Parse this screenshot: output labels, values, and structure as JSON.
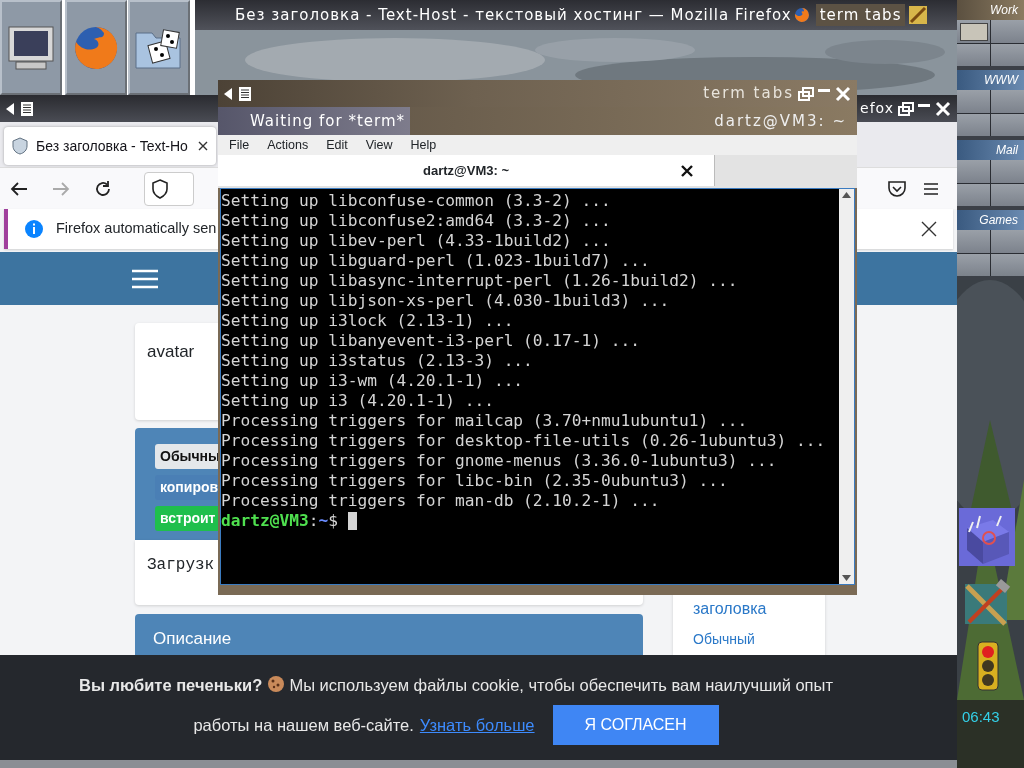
{
  "launcher": [
    {
      "kind": "monitor"
    },
    {
      "kind": "browser"
    },
    {
      "kind": "games"
    }
  ],
  "top_bar": {
    "title": "Без заголовка - Text-Host - текстовый хостинг — Mozilla Firefox",
    "second_title": "term tabs"
  },
  "pager": {
    "desks": [
      {
        "label": "Work",
        "selected": true
      },
      {
        "label": "WWW",
        "selected": false
      },
      {
        "label": "Mail",
        "selected": false
      },
      {
        "label": "Games",
        "selected": false
      }
    ]
  },
  "dock": [
    {
      "kind": "cube"
    },
    {
      "kind": "tools"
    },
    {
      "kind": "traffic-light"
    }
  ],
  "clock": "06:43",
  "firefox": {
    "title_fragment": "efox",
    "tabs": [
      {
        "title": "Без заголовка - Text-Ho",
        "selected": true
      }
    ],
    "notification": "Firefox automatically sen",
    "page": {
      "avatar_label": "avatar",
      "badges": [
        {
          "label": "Обычны",
          "color": "#e4e7ea"
        },
        {
          "label": "копиров",
          "color": "#4a7fb5"
        },
        {
          "label": "встроит",
          "color": "#1fbf4c"
        }
      ],
      "loading_text": "Загрузк",
      "description_heading": "Описание",
      "side_title": "заголовка",
      "side_link": "Обычный"
    },
    "cookie_banner": {
      "lead": "Вы любите печеньки?",
      "text": "Мы используем файлы cookie, чтобы обеспечить вам наилучший опыт",
      "text_2": "работы на нашем веб-сайте.",
      "link": "Узнать больше",
      "button": "Я СОГЛАСЕН"
    }
  },
  "terminal": {
    "window_title": "term tabs",
    "status_left": "Waiting for *term*",
    "status_right": "dartz@VM3: ~",
    "menu": [
      "File",
      "Actions",
      "Edit",
      "View",
      "Help"
    ],
    "tabs": [
      {
        "title": "dartz@VM3: ~",
        "selected": true
      }
    ],
    "lines": [
      "Setting up libconfuse-common (3.3-2) ...",
      "Setting up libconfuse2:amd64 (3.3-2) ...",
      "Setting up libev-perl (4.33-1build2) ...",
      "Setting up libguard-perl (1.023-1build7) ...",
      "Setting up libasync-interrupt-perl (1.26-1build2) ...",
      "Setting up libjson-xs-perl (4.030-1build3) ...",
      "Setting up i3lock (2.13-1) ...",
      "Setting up libanyevent-i3-perl (0.17-1) ...",
      "Setting up i3status (2.13-3) ...",
      "Setting up i3-wm (4.20.1-1) ...",
      "Setting up i3 (4.20.1-1) ...",
      "Processing triggers for mailcap (3.70+nmu1ubuntu1) ...",
      "Processing triggers for desktop-file-utils (0.26-1ubuntu3) ...",
      "Processing triggers for gnome-menus (3.36.0-1ubuntu3) ...",
      "Processing triggers for libc-bin (2.35-0ubuntu3) ...",
      "Processing triggers for man-db (2.10.2-1) ..."
    ],
    "prompt": {
      "user_host": "dartz@VM3",
      "separator": ":",
      "path": "~",
      "symbol": "$"
    }
  }
}
